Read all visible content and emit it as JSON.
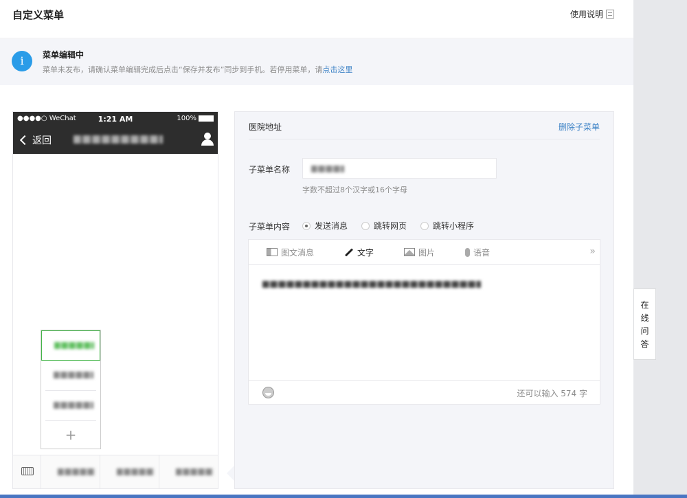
{
  "page": {
    "title": "自定义菜单",
    "help_label": "使用说明"
  },
  "notice": {
    "icon": "info-icon",
    "title": "菜单编辑中",
    "text": "菜单未发布，请确认菜单编辑完成后点击“保存并发布”同步到手机。若停用菜单，请",
    "link": "点击这里"
  },
  "phone": {
    "carrier": "●●●●○ WeChat",
    "time": "1:21 AM",
    "battery": "100%",
    "back_label": "返回",
    "submenu_add": "+"
  },
  "editor": {
    "title": "医院地址",
    "delete_label": "删除子菜单",
    "name_label": "子菜单名称",
    "name_hint": "字数不超过8个汉字或16个字母",
    "content_label": "子菜单内容",
    "options": [
      {
        "label": "发送消息",
        "checked": true
      },
      {
        "label": "跳转网页",
        "checked": false
      },
      {
        "label": "跳转小程序",
        "checked": false
      }
    ],
    "tabs": [
      {
        "label": "图文消息",
        "icon": "news-icon",
        "active": false
      },
      {
        "label": "文字",
        "icon": "pen-icon",
        "active": true
      },
      {
        "label": "图片",
        "icon": "image-icon",
        "active": false
      },
      {
        "label": "语音",
        "icon": "mic-icon",
        "active": false
      }
    ],
    "more": "»",
    "chars_left": "还可以输入 574 字"
  },
  "online_help": "在线问答",
  "colors": {
    "accent_blue": "#3e83c6",
    "info_icon": "#2a9ce8",
    "active_green": "#44b549",
    "phone_header": "#2d2d2d"
  }
}
